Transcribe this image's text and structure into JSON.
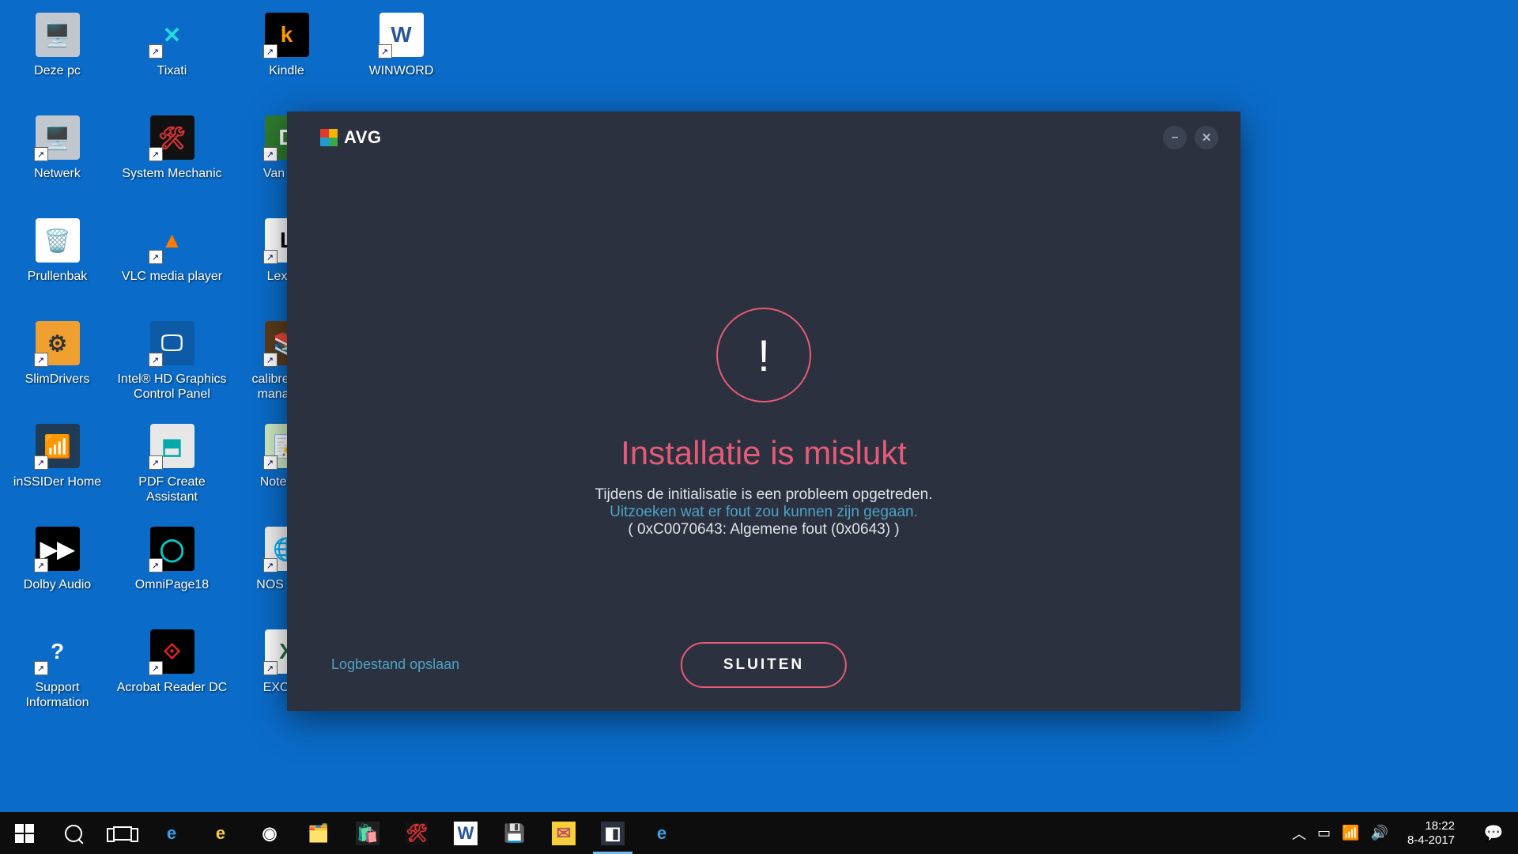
{
  "desktop": {
    "icons": [
      {
        "label": "Deze pc",
        "icon": "monitor",
        "shortcut": false,
        "bg": "#c0c7cf",
        "fg": "#3a4a63",
        "glyph": "🖥️"
      },
      {
        "label": "Netwerk",
        "icon": "network",
        "shortcut": true,
        "bg": "#c0c7cf",
        "fg": "#3a4a63",
        "glyph": "🖥️"
      },
      {
        "label": "Prullenbak",
        "icon": "recycle-bin",
        "shortcut": false,
        "bg": "#ffffff",
        "fg": "#3a4a63",
        "glyph": "🗑️"
      },
      {
        "label": "SlimDrivers",
        "icon": "slimdrivers",
        "shortcut": true,
        "bg": "#f0a030",
        "fg": "#333",
        "glyph": "⚙"
      },
      {
        "label": "inSSIDer Home",
        "icon": "inssider",
        "shortcut": true,
        "bg": "#1f3b56",
        "fg": "#ffae3a",
        "glyph": "📶"
      },
      {
        "label": "Dolby Audio",
        "icon": "dolby",
        "shortcut": true,
        "bg": "#000",
        "fg": "#fff",
        "glyph": "▶▶"
      },
      {
        "label": "Support Information",
        "icon": "support",
        "shortcut": true,
        "bg": "#0a6bc8",
        "fg": "#fff",
        "glyph": "?"
      },
      {
        "label": "Tixati",
        "icon": "tixati",
        "shortcut": true,
        "bg": "#0a6bc8",
        "fg": "#2dd",
        "glyph": "✕"
      },
      {
        "label": "System Mechanic",
        "icon": "sysmech",
        "shortcut": true,
        "bg": "#111",
        "fg": "#d33",
        "glyph": "🛠"
      },
      {
        "label": "VLC media player",
        "icon": "vlc",
        "shortcut": true,
        "bg": "transparent",
        "fg": "#ff7a00",
        "glyph": "▲"
      },
      {
        "label": "Intel® HD Graphics Control Panel",
        "icon": "intel",
        "shortcut": true,
        "bg": "#0d5aa7",
        "fg": "#fff",
        "glyph": "🖵"
      },
      {
        "label": "PDF Create Assistant",
        "icon": "pdfcreate",
        "shortcut": true,
        "bg": "#e7e7e7",
        "fg": "#0aa",
        "glyph": "⬒"
      },
      {
        "label": "OmniPage18",
        "icon": "omnipage",
        "shortcut": true,
        "bg": "#000",
        "fg": "#0cc",
        "glyph": "◯"
      },
      {
        "label": "Acrobat Reader DC",
        "icon": "acrobat",
        "shortcut": true,
        "bg": "#000",
        "fg": "#d22",
        "glyph": "⟐"
      },
      {
        "label": "Kindle",
        "icon": "kindle",
        "shortcut": true,
        "bg": "#000",
        "fg": "#f90",
        "glyph": "k"
      },
      {
        "label": "Van D…",
        "icon": "vandale",
        "shortcut": true,
        "bg": "#2f7b2f",
        "fg": "#fff",
        "glyph": "D"
      },
      {
        "label": "Lexx…",
        "icon": "lexx",
        "shortcut": true,
        "bg": "#fff",
        "fg": "#000",
        "glyph": "L"
      },
      {
        "label": "calibre - E… manage…",
        "icon": "calibre",
        "shortcut": true,
        "bg": "#5a3b1a",
        "fg": "#f3d28b",
        "glyph": "📚"
      },
      {
        "label": "Notepa…",
        "icon": "notepad",
        "shortcut": true,
        "bg": "#cfe9c3",
        "fg": "#2a6b2a",
        "glyph": "📝"
      },
      {
        "label": "NOS nie…",
        "icon": "nos",
        "shortcut": true,
        "bg": "#f2f2f2",
        "fg": "#0b69c7",
        "glyph": "🌐"
      },
      {
        "label": "EXCE…",
        "icon": "excel",
        "shortcut": true,
        "bg": "#fff",
        "fg": "#1d7044",
        "glyph": "X"
      },
      {
        "label": "WINWORD",
        "icon": "word",
        "shortcut": true,
        "bg": "#fff",
        "fg": "#2a579a",
        "glyph": "W"
      }
    ]
  },
  "dialog": {
    "brand": "AVG",
    "alert_glyph": "!",
    "title": "Installatie is mislukt",
    "subtitle": "Tijdens de initialisatie is een probleem opgetreden.",
    "help_link": "Uitzoeken wat er fout zou kunnen zijn gegaan.",
    "error_code": "(  0xC0070643: Algemene fout (0x0643)  )",
    "log_link": "Logbestand opslaan",
    "close_button": "SLUITEN"
  },
  "taskbar": {
    "apps": [
      {
        "name": "edge",
        "glyph": "e",
        "bg": "transparent",
        "fg": "#35a2ef"
      },
      {
        "name": "ie",
        "glyph": "e",
        "bg": "transparent",
        "fg": "#f7cf3a"
      },
      {
        "name": "chrome",
        "glyph": "◉",
        "bg": "transparent",
        "fg": "#fff"
      },
      {
        "name": "file-explorer",
        "glyph": "🗂️",
        "bg": "transparent",
        "fg": "#ffd667"
      },
      {
        "name": "store",
        "glyph": "🛍️",
        "bg": "#202020",
        "fg": "#fff"
      },
      {
        "name": "sysmech",
        "glyph": "🛠",
        "bg": "#111",
        "fg": "#d33"
      },
      {
        "name": "word",
        "glyph": "W",
        "bg": "#fff",
        "fg": "#2a579a"
      },
      {
        "name": "floppy",
        "glyph": "💾",
        "bg": "transparent",
        "fg": "#fff"
      },
      {
        "name": "outlook",
        "glyph": "✉",
        "bg": "#f7cf3a",
        "fg": "#b56"
      },
      {
        "name": "avg",
        "glyph": "◧",
        "bg": "#2b313e",
        "fg": "#fff",
        "active": true
      },
      {
        "name": "ie2",
        "glyph": "e",
        "bg": "transparent",
        "fg": "#3aa3e3"
      }
    ],
    "tray": {
      "time": "18:22",
      "date": "8-4-2017"
    }
  }
}
